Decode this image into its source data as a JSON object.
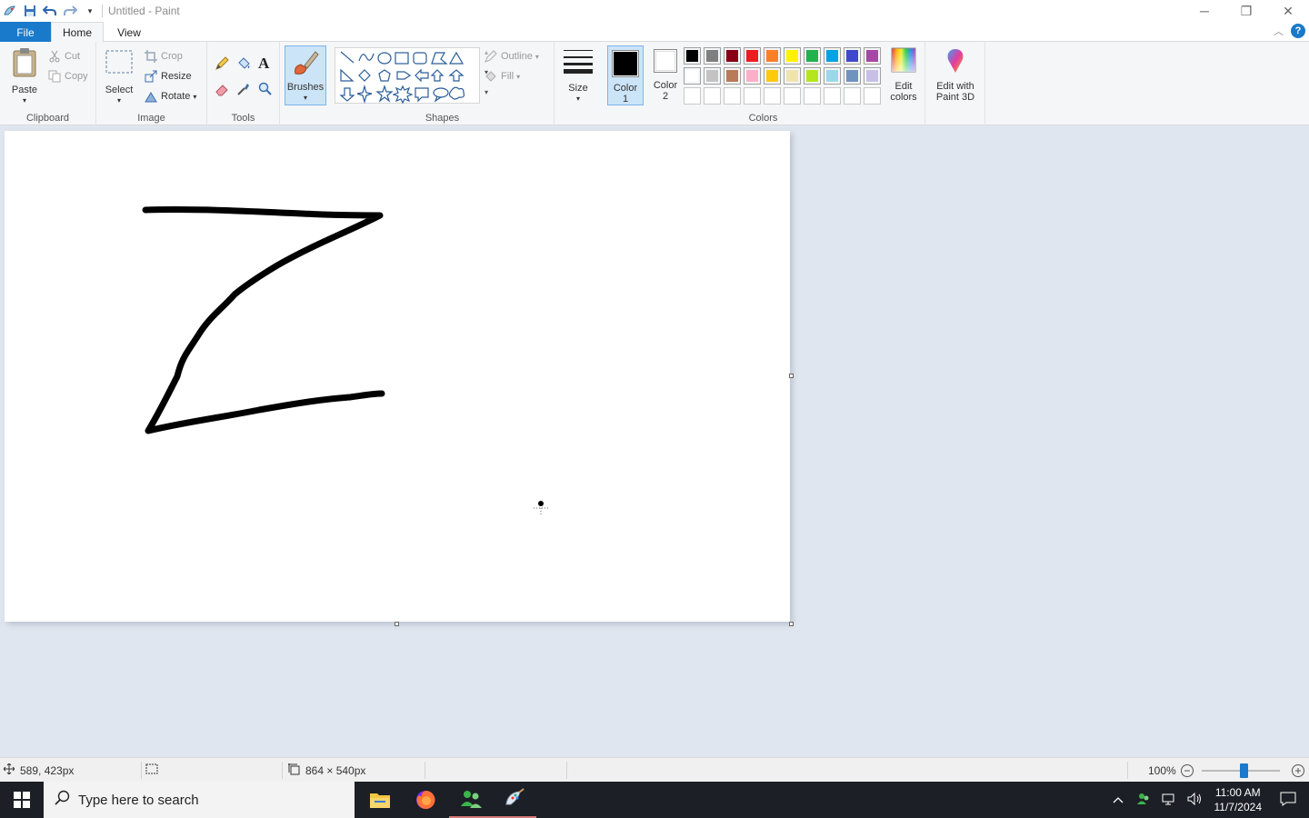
{
  "window": {
    "title": "Untitled - Paint",
    "controls": {
      "minimize": "─",
      "restore": "❐",
      "close": "✕"
    }
  },
  "tabs": {
    "file": "File",
    "home": "Home",
    "view": "View"
  },
  "clipboard": {
    "paste": "Paste",
    "cut": "Cut",
    "copy": "Copy",
    "label": "Clipboard"
  },
  "image": {
    "select": "Select",
    "crop": "Crop",
    "resize": "Resize",
    "rotate": "Rotate",
    "label": "Image"
  },
  "tools": {
    "label": "Tools",
    "text_glyph": "A"
  },
  "brushes": {
    "label": "Brushes"
  },
  "shapes": {
    "outline": "Outline",
    "fill": "Fill",
    "label": "Shapes"
  },
  "size": {
    "label": "Size"
  },
  "colors": {
    "color1_line1": "Color",
    "color1_line2": "1",
    "color2_line1": "Color",
    "color2_line2": "2",
    "label": "Colors",
    "edit_line1": "Edit",
    "edit_line2": "colors",
    "color1_value": "#000000",
    "color2_value": "#ffffff",
    "palette_row1": [
      "#000000",
      "#7f7f7f",
      "#880015",
      "#ed1c24",
      "#ff7f27",
      "#fff200",
      "#22b14c",
      "#00a2e8",
      "#3f48cc",
      "#a349a4"
    ],
    "palette_row2": [
      "#ffffff",
      "#c3c3c3",
      "#b97a57",
      "#ffaec9",
      "#ffc90e",
      "#efe4b0",
      "#b5e61d",
      "#99d9ea",
      "#7092be",
      "#c8bfe7"
    ]
  },
  "paint3d": {
    "line1": "Edit with",
    "line2": "Paint 3D"
  },
  "status": {
    "cursor_pos": "589, 423px",
    "canvas_size": "864 × 540px",
    "zoom": "100%",
    "zoom_level": 1.0
  },
  "taskbar": {
    "search_placeholder": "Type here to search",
    "time": "11:00 AM",
    "date": "11/7/2024"
  }
}
